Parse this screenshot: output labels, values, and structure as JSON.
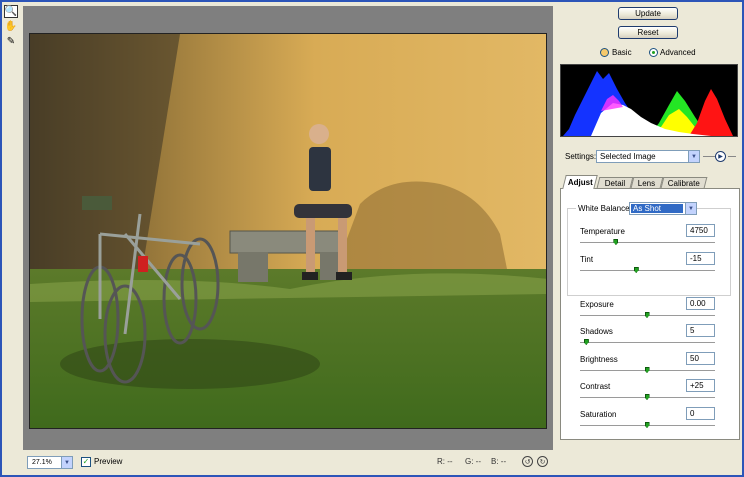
{
  "toolbar": {
    "tools": [
      {
        "name": "zoom-icon",
        "glyph": "🔍"
      },
      {
        "name": "hand-icon",
        "glyph": "✋"
      },
      {
        "name": "eyedropper-icon",
        "glyph": "✎"
      }
    ]
  },
  "status": {
    "zoom": "27.1%",
    "preview_label": "Preview",
    "preview_checked": true,
    "r": "R:  --",
    "g": "G:  --",
    "b": "B:  --"
  },
  "panel": {
    "update_label": "Update",
    "reset_label": "Reset",
    "mode_basic": "Basic",
    "mode_advanced": "Advanced",
    "mode_selected": "Advanced",
    "settings_label": "Settings:",
    "settings_value": "Selected Image",
    "tabs": [
      "Adjust",
      "Detail",
      "Lens",
      "Calibrate"
    ],
    "active_tab": "Adjust",
    "white_balance_label": "White Balance:",
    "white_balance_value": "As Shot",
    "controls": [
      {
        "label": "Temperature",
        "value": "4750",
        "level": 0.27
      },
      {
        "label": "Tint",
        "value": "-15",
        "level": 0.42
      },
      {
        "label": "Exposure",
        "value": "0.00",
        "level": 0.5
      },
      {
        "label": "Shadows",
        "value": "5",
        "level": 0.05
      },
      {
        "label": "Brightness",
        "value": "50",
        "level": 0.5
      },
      {
        "label": "Contrast",
        "value": "+25",
        "level": 0.5
      },
      {
        "label": "Saturation",
        "value": "0",
        "level": 0.5
      }
    ]
  },
  "colors": {
    "frame": "#2c55b8",
    "canvas": "#7f7f7f",
    "slider_thumb": "#21a121",
    "selection": "#316ac5"
  }
}
